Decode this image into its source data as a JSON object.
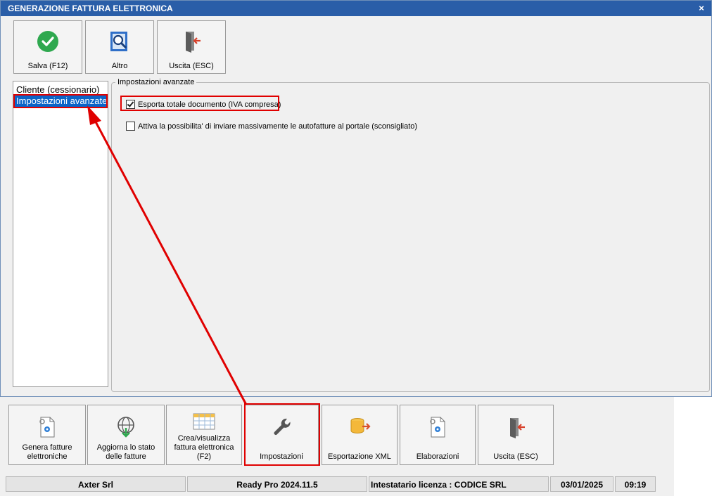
{
  "dialog": {
    "title": "GENERAZIONE FATTURA ELETTRONICA",
    "close_label": "×",
    "toolbar": {
      "save_label": "Salva (F12)",
      "other_label": "Altro",
      "exit_label": "Uscita (ESC)"
    },
    "nav": {
      "items": [
        {
          "label": "Cliente (cessionario)",
          "selected": false
        },
        {
          "label": "Impostazioni avanzate",
          "selected": true
        }
      ]
    },
    "group": {
      "title": "Impostazioni avanzate",
      "options": [
        {
          "label": "Esporta totale documento (IVA compresa)",
          "checked": true
        },
        {
          "label": "Attiva la possibilita' di inviare massivamente le autofatture al portale (sconsigliato)",
          "checked": false
        }
      ]
    }
  },
  "main": {
    "toolbar": [
      {
        "label": "Genera fatture elettroniche",
        "icon": "document-gear-icon"
      },
      {
        "label": "Aggiorna lo stato delle fatture",
        "icon": "globe-download-icon"
      },
      {
        "label": "Crea/visualizza fattura elettronica (F2)",
        "icon": "spreadsheet-icon"
      },
      {
        "label": "Impostazioni",
        "icon": "wrench-icon"
      },
      {
        "label": "Esportazione XML",
        "icon": "database-export-icon"
      },
      {
        "label": "Elaborazioni",
        "icon": "document-gear-icon"
      },
      {
        "label": "Uscita (ESC)",
        "icon": "exit-door-icon"
      }
    ],
    "status": {
      "company": "Axter Srl",
      "version": "Ready Pro 2024.11.5",
      "license": "Intestatario licenza : CODICE SRL",
      "date": "03/01/2025",
      "time": "09:19"
    }
  },
  "colors": {
    "title_bar": "#2a5ea8",
    "selection": "#0a64c8",
    "highlight": "#e00000",
    "check_green": "#2fa84f"
  }
}
